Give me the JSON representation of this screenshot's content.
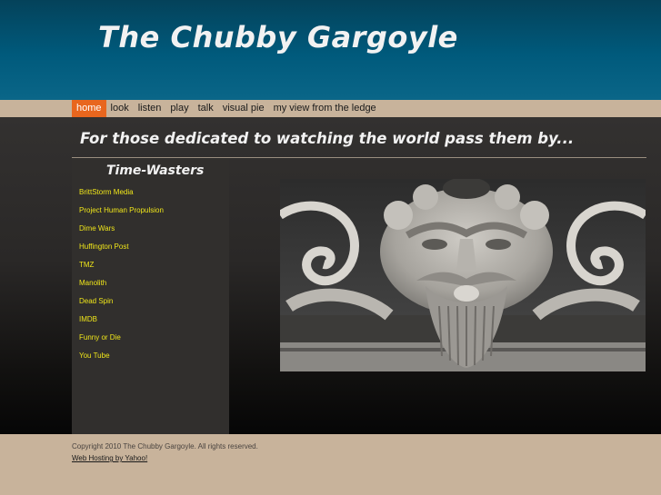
{
  "site": {
    "title": "The Chubby Gargoyle"
  },
  "nav": {
    "items": [
      {
        "label": "home"
      },
      {
        "label": "look"
      },
      {
        "label": "listen"
      },
      {
        "label": "play"
      },
      {
        "label": "talk"
      },
      {
        "label": "visual pie"
      },
      {
        "label": "my view from the ledge"
      }
    ],
    "active": "home"
  },
  "main": {
    "tagline": "For those dedicated to watching the world pass them by...",
    "sidebar": {
      "title": "Time-Wasters",
      "links": [
        {
          "label": "BrittStorm Media"
        },
        {
          "label": "Project Human Propulsion"
        },
        {
          "label": "Dime Wars"
        },
        {
          "label": "Huffington Post"
        },
        {
          "label": "TMZ"
        },
        {
          "label": "Manolith"
        },
        {
          "label": "Dead Spin"
        },
        {
          "label": "IMDB"
        },
        {
          "label": "Funny or Die"
        },
        {
          "label": "You Tube"
        }
      ]
    }
  },
  "footer": {
    "copyright": "Copyright 2010 The Chubby Gargoyle. All rights reserved.",
    "hosting": "Web Hosting by Yahoo!"
  },
  "colors": {
    "header": "#005a7c",
    "nav_bg": "#c8b39b",
    "nav_active": "#e8661e",
    "sidebar_bg": "#312f2d",
    "link": "#f0e61a"
  }
}
